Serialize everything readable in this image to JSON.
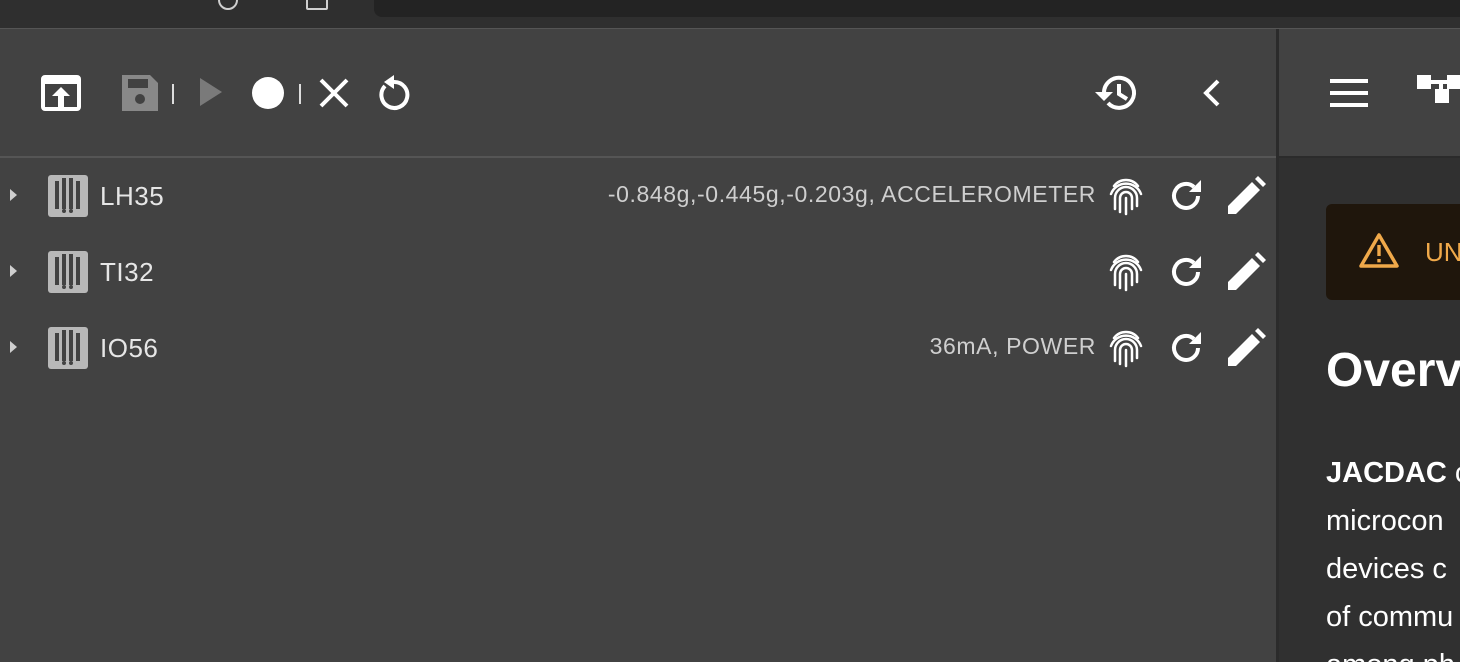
{
  "toolbar": {
    "upload_icon": "upload-icon",
    "save_icon": "save-icon",
    "play_icon": "play-icon",
    "record_icon": "record-icon",
    "clear_icon": "close-icon",
    "restart_icon": "restart-icon",
    "history_icon": "history-icon",
    "collapse_icon": "chevron-left-icon"
  },
  "devices": [
    {
      "name": "LH35",
      "reading": "-0.848g,-0.445g,-0.203g, ACCELEROMETER"
    },
    {
      "name": "TI32",
      "reading": ""
    },
    {
      "name": "IO56",
      "reading": "36mA, POWER"
    }
  ],
  "right_panel": {
    "menu_icon": "menu-icon",
    "tree_icon": "device-tree-icon",
    "warning_text": "UN",
    "heading": "Overv",
    "paragraph_lines": [
      {
        "bold": "JACDAC",
        "rest": " c"
      },
      {
        "bold": "",
        "rest": "microcon"
      },
      {
        "bold": "",
        "rest": "devices c"
      },
      {
        "bold": "",
        "rest": "of commu"
      },
      {
        "bold": "",
        "rest": "among ph"
      }
    ]
  },
  "colors": {
    "background": "#424242",
    "panel": "#303030",
    "warning_bg": "#1f160c",
    "warning_text": "#f0a94a"
  }
}
